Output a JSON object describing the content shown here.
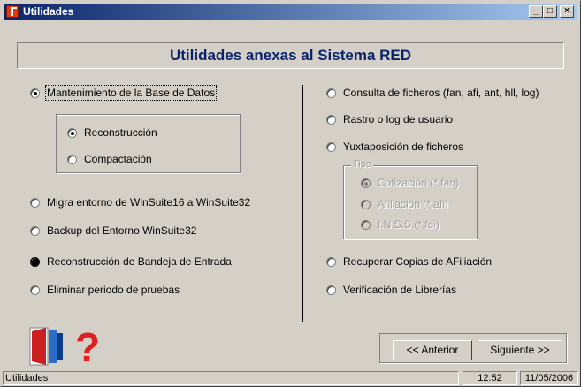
{
  "window": {
    "title": "Utilidades",
    "controls": {
      "minimize": "_",
      "maximize": "□",
      "close": "×"
    }
  },
  "header": {
    "title": "Utilidades anexas al Sistema RED"
  },
  "left_options": [
    {
      "label": "Mantenimiento de la Base de Datos",
      "selected": true
    },
    {
      "label": "Migra entorno de WinSuite16 a WinSuite32",
      "selected": false
    },
    {
      "label": "Backup del Entorno WinSuite32",
      "selected": false
    },
    {
      "label": "Reconstrucción de Bandeja de Entrada",
      "selected": false
    },
    {
      "label": "Eliminar periodo de pruebas",
      "selected": false
    }
  ],
  "maintenance_sub": [
    {
      "label": "Reconstrucción",
      "selected": true
    },
    {
      "label": "Compactación",
      "selected": false
    }
  ],
  "right_options": [
    {
      "label": "Consulta de ficheros (fan, afi, ant, hll, log)",
      "selected": false
    },
    {
      "label": "Rastro o log de usuario",
      "selected": false
    },
    {
      "label": "Yuxtaposición de ficheros",
      "selected": false
    },
    {
      "label": "Recuperar Copias de AFiliación",
      "selected": false
    },
    {
      "label": "Verificación de Librerías",
      "selected": false
    }
  ],
  "tipo_group": {
    "legend": "Tipo",
    "options": [
      {
        "label": "Cotización (*.fan)",
        "selected": true
      },
      {
        "label": "Afiliación (*.afi)",
        "selected": false
      },
      {
        "label": "I.N.S.S.(*.fdi)",
        "selected": false
      }
    ]
  },
  "buttons": {
    "prev_label": "<< Anterior",
    "next_label": "Siguiente >>"
  },
  "icons": {
    "exit": "door-exit-icon",
    "help": "help-question-icon"
  },
  "colors": {
    "title_text": "#0a246a",
    "help_icon": "#e02020",
    "door_icon": "#cc1f1f"
  },
  "status": {
    "text": "Utilidades",
    "time": "12:52",
    "date": "11/05/2006"
  }
}
